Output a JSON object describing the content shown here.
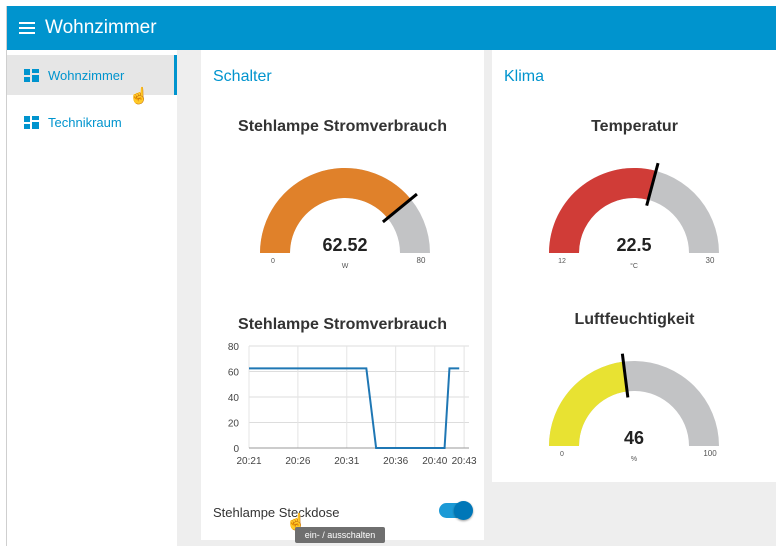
{
  "header": {
    "title": "Wohnzimmer"
  },
  "sidebar": {
    "items": [
      {
        "label": "Wohnzimmer",
        "active": true
      },
      {
        "label": "Technikraum",
        "active": false
      }
    ]
  },
  "groups": {
    "schalter": {
      "title": "Schalter",
      "power_gauge": {
        "title": "Stehlampe Stromverbrauch",
        "value": "62.52",
        "unit": "W",
        "min": "0",
        "max": "80",
        "fraction": 0.7815,
        "color": "#e0812a"
      },
      "power_chart_title": "Stehlampe Stromverbrauch",
      "switch": {
        "label": "Stehlampe Steckdose",
        "state": "on",
        "tooltip": "ein- / ausschalten"
      }
    },
    "klima": {
      "title": "Klima",
      "temperature_gauge": {
        "title": "Temperatur",
        "value": "22.5",
        "unit": "°C",
        "min": "12",
        "max": "30",
        "fraction": 0.5833,
        "color": "#d03c37"
      },
      "humidity_gauge": {
        "title": "Luftfeuchtigkeit",
        "value": "46",
        "unit": "%",
        "min": "0",
        "max": "100",
        "fraction": 0.46,
        "color": "#e8e232"
      }
    }
  },
  "chart_data": {
    "type": "line",
    "title": "Stehlampe Stromverbrauch",
    "xlabel": "",
    "ylabel": "",
    "x_ticks": [
      "20:21",
      "20:26",
      "20:31",
      "20:36",
      "20:40",
      "20:43"
    ],
    "y_ticks": [
      0,
      20,
      40,
      60,
      80
    ],
    "ylim": [
      0,
      80
    ],
    "x_range_minutes": [
      0,
      22.5
    ],
    "grid": true,
    "series": [
      {
        "x": [
          "20:21",
          "20:33",
          "20:34",
          "20:41",
          "20:41.5",
          "20:42.5"
        ],
        "values": [
          62.5,
          62.5,
          0,
          0,
          62.5,
          62.5
        ],
        "color": "#1f77b4"
      }
    ]
  }
}
